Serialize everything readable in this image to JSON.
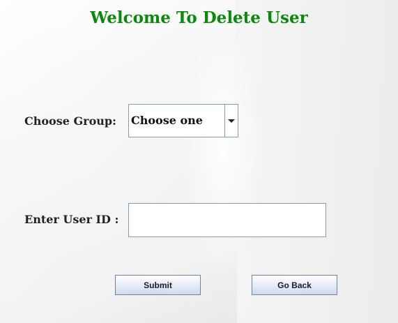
{
  "page": {
    "title": "Welcome To Delete User"
  },
  "form": {
    "group_label": "Choose Group:",
    "group_select": {
      "selected": "Choose one"
    },
    "userid_label": "Enter User ID :",
    "userid_input": {
      "value": "",
      "placeholder": ""
    }
  },
  "buttons": {
    "submit_label": "Submit",
    "back_label": "Go Back"
  },
  "colors": {
    "title": "#0a8a0a",
    "field_border": "#7f9db9",
    "button_border": "#6a83a8"
  },
  "icons": {
    "dropdown": "triangle-down-icon"
  }
}
